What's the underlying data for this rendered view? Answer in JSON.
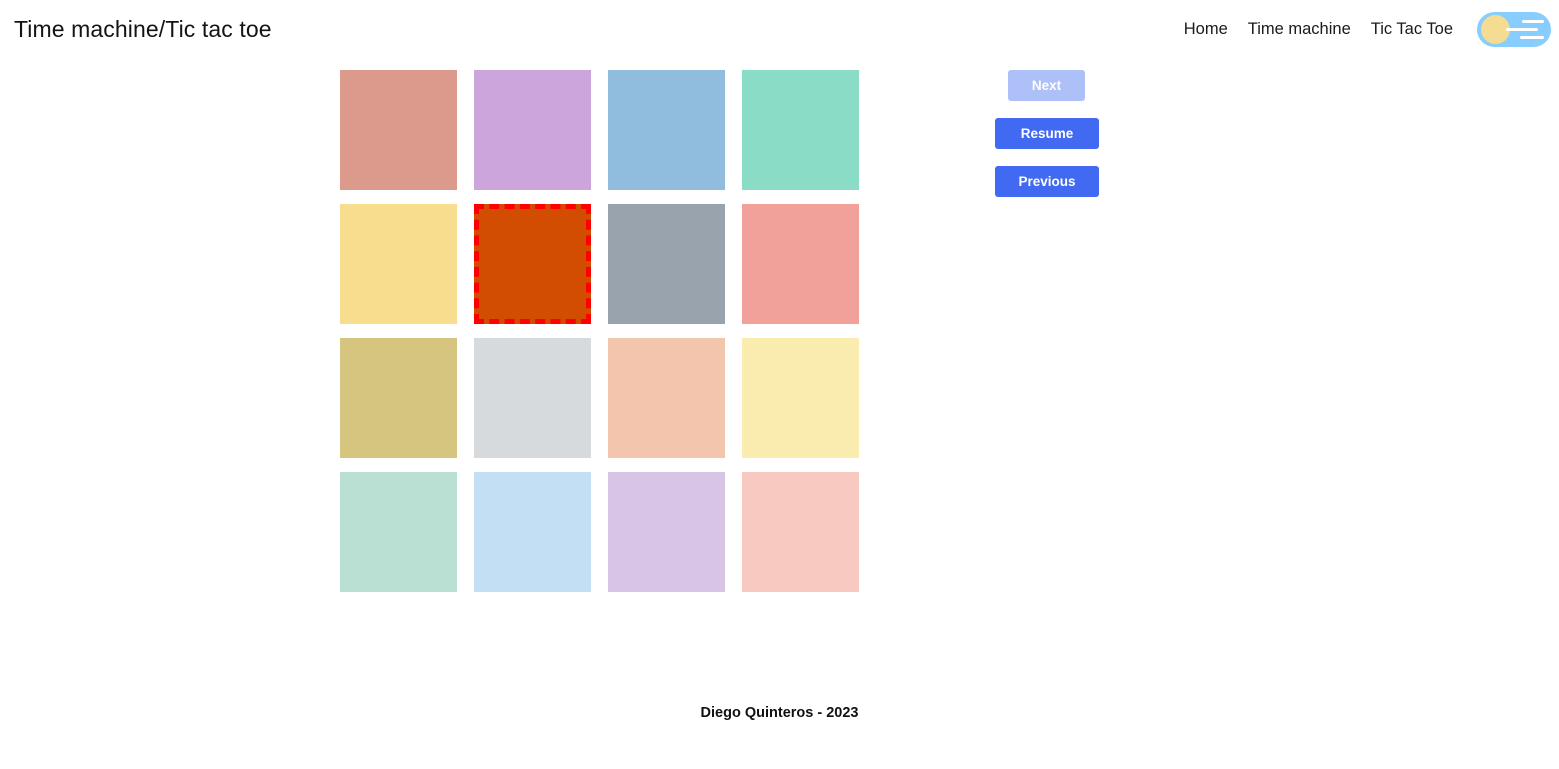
{
  "header": {
    "title": "Time machine/Tic tac toe",
    "nav": [
      {
        "label": "Home",
        "name": "nav-link-home"
      },
      {
        "label": "Time machine",
        "name": "nav-link-time-machine"
      },
      {
        "label": "Tic Tac Toe",
        "name": "nav-link-tic-tac-toe"
      }
    ],
    "theme_toggle": {
      "icon": "sun-icon",
      "state": "light",
      "track_color": "#87ceff",
      "knob_color": "#f4dc92"
    }
  },
  "board": {
    "rows": 4,
    "columns": 4,
    "cell_size_px": 117,
    "selected_index": 5,
    "selection_border_color": "#ff0000",
    "cells": [
      {
        "index": 0,
        "color": "#dc9a8d",
        "selected": false
      },
      {
        "index": 1,
        "color": "#cca5dd",
        "selected": false
      },
      {
        "index": 2,
        "color": "#90bcdd",
        "selected": false
      },
      {
        "index": 3,
        "color": "#8adcc6",
        "selected": false
      },
      {
        "index": 4,
        "color": "#f7dd8d",
        "selected": false
      },
      {
        "index": 5,
        "color": "#d24c02",
        "selected": true
      },
      {
        "index": 6,
        "color": "#99a3ad",
        "selected": false
      },
      {
        "index": 7,
        "color": "#f1a09a",
        "selected": false
      },
      {
        "index": 8,
        "color": "#d5c57f",
        "selected": false
      },
      {
        "index": 9,
        "color": "#d7dadd",
        "selected": false
      },
      {
        "index": 10,
        "color": "#f3c5ac",
        "selected": false
      },
      {
        "index": 11,
        "color": "#f9ecae",
        "selected": false
      },
      {
        "index": 12,
        "color": "#bae0d4",
        "selected": false
      },
      {
        "index": 13,
        "color": "#c3dff4",
        "selected": false
      },
      {
        "index": 14,
        "color": "#d8c5e5",
        "selected": false
      },
      {
        "index": 15,
        "color": "#f8c9c1",
        "selected": false
      }
    ]
  },
  "controls": {
    "next_label": "Next",
    "next_disabled": true,
    "resume_label": "Resume",
    "previous_label": "Previous",
    "active_color": "#4169f2",
    "disabled_color": "#aec0f8"
  },
  "footer": {
    "credit": "Diego Quinteros - 2023"
  }
}
